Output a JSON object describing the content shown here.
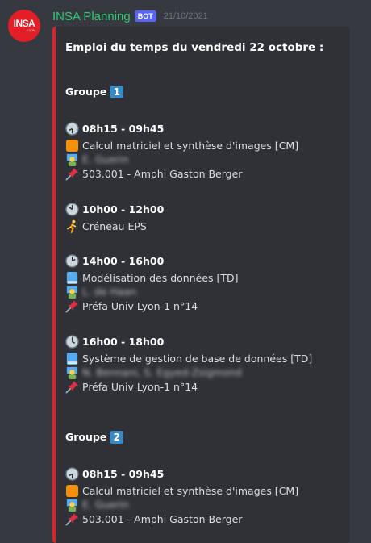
{
  "message": {
    "avatar_text": "INSA",
    "avatar_subtext": "LYON",
    "username": "INSA Planning",
    "bot_tag": "BOT",
    "timestamp": "21/10/2021"
  },
  "embed": {
    "accent_color": "#e21e26",
    "title": "Emploi du temps du vendredi 22 octobre :",
    "groups": [
      {
        "label": "Groupe",
        "number": "1",
        "slots": [
          {
            "clock_icon": "clock-eight-thirty-icon",
            "time": "08h15 - 09h45",
            "course_icon": "orange-square-icon",
            "course": "Calcul matriciel et synthèse d'images [CM]",
            "teacher": "E. Guerin",
            "room": "503.001 - Amphi Gaston Berger"
          },
          {
            "clock_icon": "clock-ten-icon",
            "time": "10h00 - 12h00",
            "course_icon": "runner-icon",
            "course": "Créneau EPS"
          },
          {
            "clock_icon": "clock-two-icon",
            "time": "14h00 - 16h00",
            "course_icon": "blue-book-icon",
            "course": "Modélisation des données [TD]",
            "teacher": "L. de Haan",
            "room": "Préfa Univ Lyon-1 n°14"
          },
          {
            "clock_icon": "clock-four-icon",
            "time": "16h00 - 18h00",
            "course_icon": "blue-book-icon",
            "course": "Système de gestion de base de données [TD]",
            "teacher": "N. Bennani, S. Egyed-Zsigmond",
            "room": "Préfa Univ Lyon-1 n°14"
          }
        ]
      },
      {
        "label": "Groupe",
        "number": "2",
        "slots": [
          {
            "clock_icon": "clock-eight-thirty-icon",
            "time": "08h15 - 09h45",
            "course_icon": "orange-square-icon",
            "course": "Calcul matriciel et synthèse d'images [CM]",
            "teacher": "E. Guerin",
            "room": "503.001 - Amphi Gaston Berger"
          }
        ]
      }
    ]
  }
}
